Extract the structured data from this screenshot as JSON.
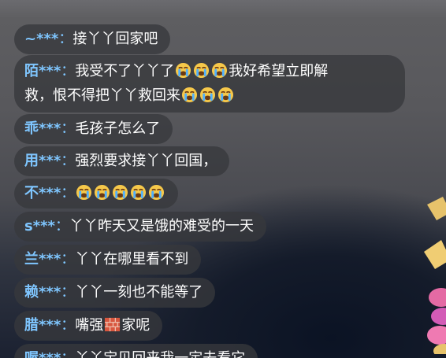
{
  "chat": {
    "separator": "：",
    "messages": [
      {
        "user": "~***",
        "text": "接丫丫回家吧"
      },
      {
        "user": "陌***",
        "line1": "我受不了丫丫了",
        "line1_tail": "我好希望立即解",
        "line2": "救，恨不得把丫丫救回来"
      },
      {
        "user": "乖***",
        "text": "毛孩子怎么了"
      },
      {
        "user": "用***",
        "text": "强烈要求接丫丫回国，"
      },
      {
        "user": "不***",
        "text": ""
      },
      {
        "user": "s***",
        "text": "丫丫昨天又是饿的难受的一天"
      },
      {
        "user": "兰***",
        "text": "丫丫在哪里看不到"
      },
      {
        "user": "赖***",
        "text": "丫丫一刻也不能等了"
      },
      {
        "user": "腊***",
        "text_before": "嘴强",
        "text_after": "家呢"
      },
      {
        "user": "喔***",
        "text": "丫丫宝贝回来我一定去看它"
      }
    ]
  },
  "icons": {
    "crying": "crying-face-icon",
    "brick": "brick-icon"
  },
  "colors": {
    "username": "#7fc6ff",
    "bubble": "#37383c",
    "text": "#ffffff"
  }
}
